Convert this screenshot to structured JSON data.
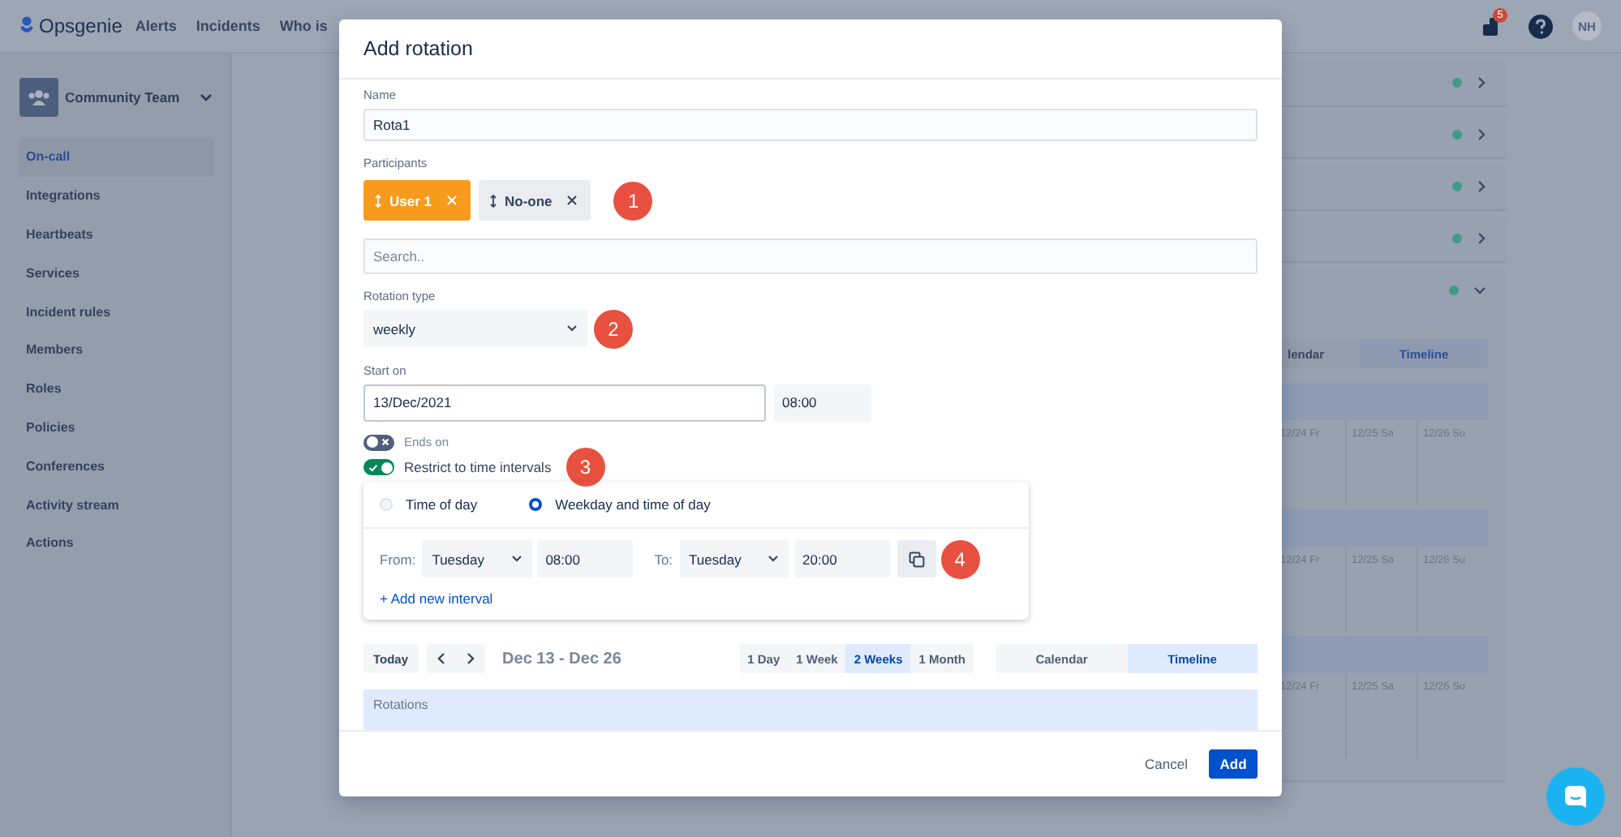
{
  "top_nav": {
    "logo": "Opsgenie",
    "links": [
      "Alerts",
      "Incidents",
      "Who is"
    ],
    "notification_count": "5",
    "avatar": "NH"
  },
  "sidebar": {
    "team": "Community Team",
    "items": [
      {
        "label": "On-call",
        "selected": true
      },
      {
        "label": "Integrations",
        "selected": false
      },
      {
        "label": "Heartbeats",
        "selected": false
      },
      {
        "label": "Services",
        "selected": false
      },
      {
        "label": "Incident rules",
        "selected": false
      },
      {
        "label": "Members",
        "selected": false
      },
      {
        "label": "Roles",
        "selected": false
      },
      {
        "label": "Policies",
        "selected": false
      },
      {
        "label": "Conferences",
        "selected": false
      },
      {
        "label": "Activity stream",
        "selected": false
      },
      {
        "label": "Actions",
        "selected": false
      }
    ]
  },
  "schedule_cards": [
    {
      "expanded": false
    },
    {
      "expanded": false
    },
    {
      "expanded": false
    },
    {
      "expanded": false
    },
    {
      "expanded": true,
      "view_tabs": [
        {
          "label": "lendar",
          "selected": false
        },
        {
          "label": "Timeline",
          "selected": true
        }
      ],
      "day_groups": [
        [
          "12/24 Fr",
          "12/25 Sa",
          "12/26 Su"
        ],
        [
          "12/24 Fr",
          "12/25 Sa",
          "12/26 Su"
        ],
        [
          "12/24 Fr",
          "12/25 Sa",
          "12/26 Su"
        ]
      ]
    }
  ],
  "modal": {
    "title": "Add rotation",
    "name_field": {
      "label": "Name",
      "value": "Rota1"
    },
    "participants": {
      "label": "Participants",
      "chips": [
        {
          "label": "User 1",
          "kind": "user"
        },
        {
          "label": "No-one",
          "kind": "no-one"
        }
      ]
    },
    "search": {
      "placeholder": "Search.."
    },
    "rotation_type": {
      "label": "Rotation type",
      "value": "weekly"
    },
    "start_on": {
      "label": "Start on",
      "date": "13/Dec/2021",
      "time": "08:00"
    },
    "toggles": [
      {
        "label": "Ends on",
        "on": false
      },
      {
        "label": "Restrict to time intervals",
        "on": true
      }
    ],
    "restriction": {
      "options": [
        {
          "label": "Time of day",
          "selected": false
        },
        {
          "label": "Weekday and time of day",
          "selected": true
        }
      ],
      "intervals": [
        {
          "from_label": "From:",
          "from_day": "Tuesday",
          "from_time": "08:00",
          "to_label": "To:",
          "to_day": "Tuesday",
          "to_time": "20:00"
        }
      ],
      "add_link": "+ Add new interval"
    },
    "calendar_toolbar": {
      "today": "Today",
      "range": "Dec 13 - Dec 26",
      "periods": [
        {
          "label": "1 Day",
          "selected": false
        },
        {
          "label": "1 Week",
          "selected": false
        },
        {
          "label": "2 Weeks",
          "selected": true
        },
        {
          "label": "1 Month",
          "selected": false
        }
      ],
      "views": [
        {
          "label": "Calendar",
          "selected": false
        },
        {
          "label": "Timeline",
          "selected": true
        }
      ]
    },
    "rotations_header": "Rotations",
    "buttons": {
      "cancel": "Cancel",
      "add": "Add"
    },
    "annotations": [
      "1",
      "2",
      "3",
      "4"
    ]
  }
}
